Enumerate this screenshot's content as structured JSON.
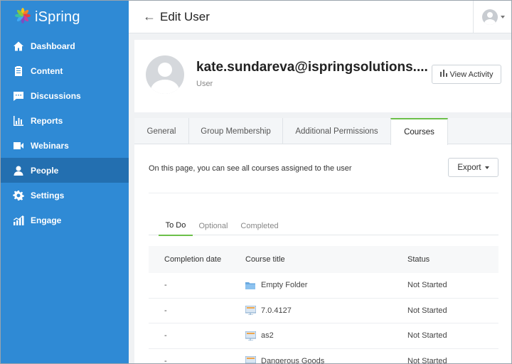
{
  "brand": {
    "name": "iSpring"
  },
  "sidebar": {
    "items": [
      {
        "label": "Dashboard",
        "icon": "home-icon"
      },
      {
        "label": "Content",
        "icon": "content-icon"
      },
      {
        "label": "Discussions",
        "icon": "chat-icon"
      },
      {
        "label": "Reports",
        "icon": "bar-chart-icon"
      },
      {
        "label": "Webinars",
        "icon": "video-icon"
      },
      {
        "label": "People",
        "icon": "person-icon",
        "active": true
      },
      {
        "label": "Settings",
        "icon": "gear-icon"
      },
      {
        "label": "Engage",
        "icon": "engage-icon"
      }
    ]
  },
  "header": {
    "back_icon": "←",
    "title": "Edit User"
  },
  "profile": {
    "email": "kate.sundareva@ispringsolutions....",
    "role": "User",
    "view_activity_label": "View Activity"
  },
  "tabs": [
    {
      "label": "General"
    },
    {
      "label": "Group Membership"
    },
    {
      "label": "Additional Permissions"
    },
    {
      "label": "Courses",
      "active": true
    }
  ],
  "courses_page": {
    "intro": "On this page, you can see all courses assigned to the user",
    "export_label": "Export",
    "subtabs": [
      {
        "label": "To Do",
        "active": true
      },
      {
        "label": "Optional"
      },
      {
        "label": "Completed"
      }
    ],
    "columns": [
      "Completion date",
      "Course title",
      "Status"
    ],
    "rows": [
      {
        "date": "-",
        "title": "Empty Folder",
        "status": "Not Started",
        "icon": "folder-icon"
      },
      {
        "date": "-",
        "title": "7.0.4127",
        "status": "Not Started",
        "icon": "presentation-icon"
      },
      {
        "date": "-",
        "title": "as2",
        "status": "Not Started",
        "icon": "presentation-icon"
      },
      {
        "date": "-",
        "title": "Dangerous Goods",
        "status": "Not Started",
        "icon": "presentation-icon"
      }
    ]
  },
  "colors": {
    "sidebar": "#2f8ad5",
    "sidebar_active": "#236fb0",
    "accent": "#6cc04a"
  }
}
